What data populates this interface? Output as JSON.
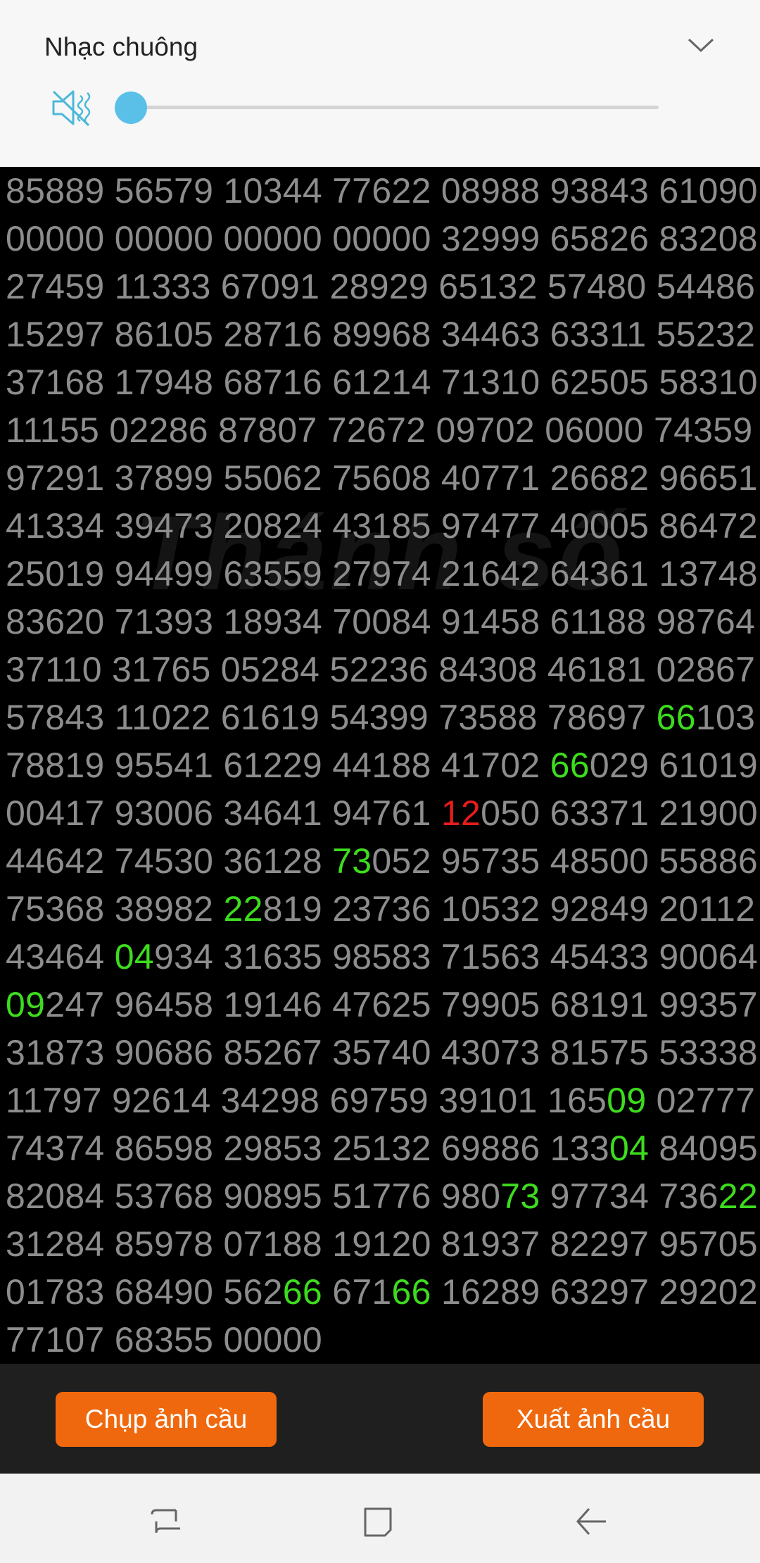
{
  "volume_panel": {
    "title": "Nhạc chuông",
    "level": 0,
    "icons": {
      "mute": "speaker-mute-icon",
      "expand": "chevron-down-icon"
    },
    "accent_color": "#5bc0e8"
  },
  "number_grid": {
    "watermark": "Thánh số",
    "text_color": "#8d8d8d",
    "highlight_green": "#3ddc1e",
    "highlight_red": "#e61c1c",
    "rows": [
      [
        {
          "t": "85889 56579 10344 77622 08988 93843 61090"
        }
      ],
      [
        {
          "t": "00000 00000 00000 00000 32999 65826 83208"
        }
      ],
      [
        {
          "t": "27459 11333 67091 28929 65132 57480 54486"
        }
      ],
      [
        {
          "t": "15297 86105 28716 89968 34463 63311 55232"
        }
      ],
      [
        {
          "t": "37168 17948 68716 61214 71310 62505 58310"
        }
      ],
      [
        {
          "t": "11155 02286 87807 72672 09702 06000 74359"
        }
      ],
      [
        {
          "t": "97291 37899 55062 75608 40771 26682 96651"
        }
      ],
      [
        {
          "t": "41334 39473 20824 43185 97477 40005 86472"
        }
      ],
      [
        {
          "t": "25019 94499 63559 27974 21642 64361 13748"
        }
      ],
      [
        {
          "t": "83620 71393 18934 70084 91458 61188 98764"
        }
      ],
      [
        {
          "t": "37110 31765 05284 52236 84308 46181 02867"
        }
      ],
      [
        {
          "t": "57843 11022 61619 54399 73588 78697 "
        },
        {
          "t": "66",
          "c": "green"
        },
        {
          "t": "103"
        }
      ],
      [
        {
          "t": "78819 95541 61229 44188 41702 "
        },
        {
          "t": "66",
          "c": "green"
        },
        {
          "t": "029 61019"
        }
      ],
      [
        {
          "t": "00417 93006 34641 94761 "
        },
        {
          "t": "12",
          "c": "red"
        },
        {
          "t": "050 63371 21900"
        }
      ],
      [
        {
          "t": "44642 74530 36128 "
        },
        {
          "t": "73",
          "c": "green"
        },
        {
          "t": "052 95735 48500 55886"
        }
      ],
      [
        {
          "t": "75368 38982 "
        },
        {
          "t": "22",
          "c": "green"
        },
        {
          "t": "819 23736 10532 92849 20112"
        }
      ],
      [
        {
          "t": "43464 "
        },
        {
          "t": "04",
          "c": "green"
        },
        {
          "t": "934 31635 98583 71563 45433 90064"
        }
      ],
      [
        {
          "t": "09",
          "c": "green"
        },
        {
          "t": "247 96458 19146 47625 79905 68191 99357"
        }
      ],
      [
        {
          "t": "31873 90686 85267 35740 43073 81575 53338"
        }
      ],
      [
        {
          "t": "11797 92614 34298 69759 39101 165"
        },
        {
          "t": "09",
          "c": "green"
        },
        {
          "t": " 02777"
        }
      ],
      [
        {
          "t": "74374 86598 29853 25132 69886 133"
        },
        {
          "t": "04",
          "c": "green"
        },
        {
          "t": " 84095"
        }
      ],
      [
        {
          "t": "82084 53768 90895 51776 980"
        },
        {
          "t": "73",
          "c": "green"
        },
        {
          "t": " 97734 736"
        },
        {
          "t": "22",
          "c": "green"
        }
      ],
      [
        {
          "t": "31284 85978 07188 19120 81937 82297 95705"
        }
      ],
      [
        {
          "t": "01783 68490 562"
        },
        {
          "t": "66",
          "c": "green"
        },
        {
          "t": " 671"
        },
        {
          "t": "66",
          "c": "green"
        },
        {
          "t": " 16289 63297 29202"
        }
      ],
      [
        {
          "t": "77107 68355 00000"
        }
      ]
    ]
  },
  "buttons": {
    "capture": "Chụp ảnh cầu",
    "export": "Xuất ảnh cầu",
    "color": "#f0680d"
  },
  "nav_bar": {
    "icons": [
      "recent-apps-icon",
      "home-icon",
      "back-icon"
    ]
  }
}
